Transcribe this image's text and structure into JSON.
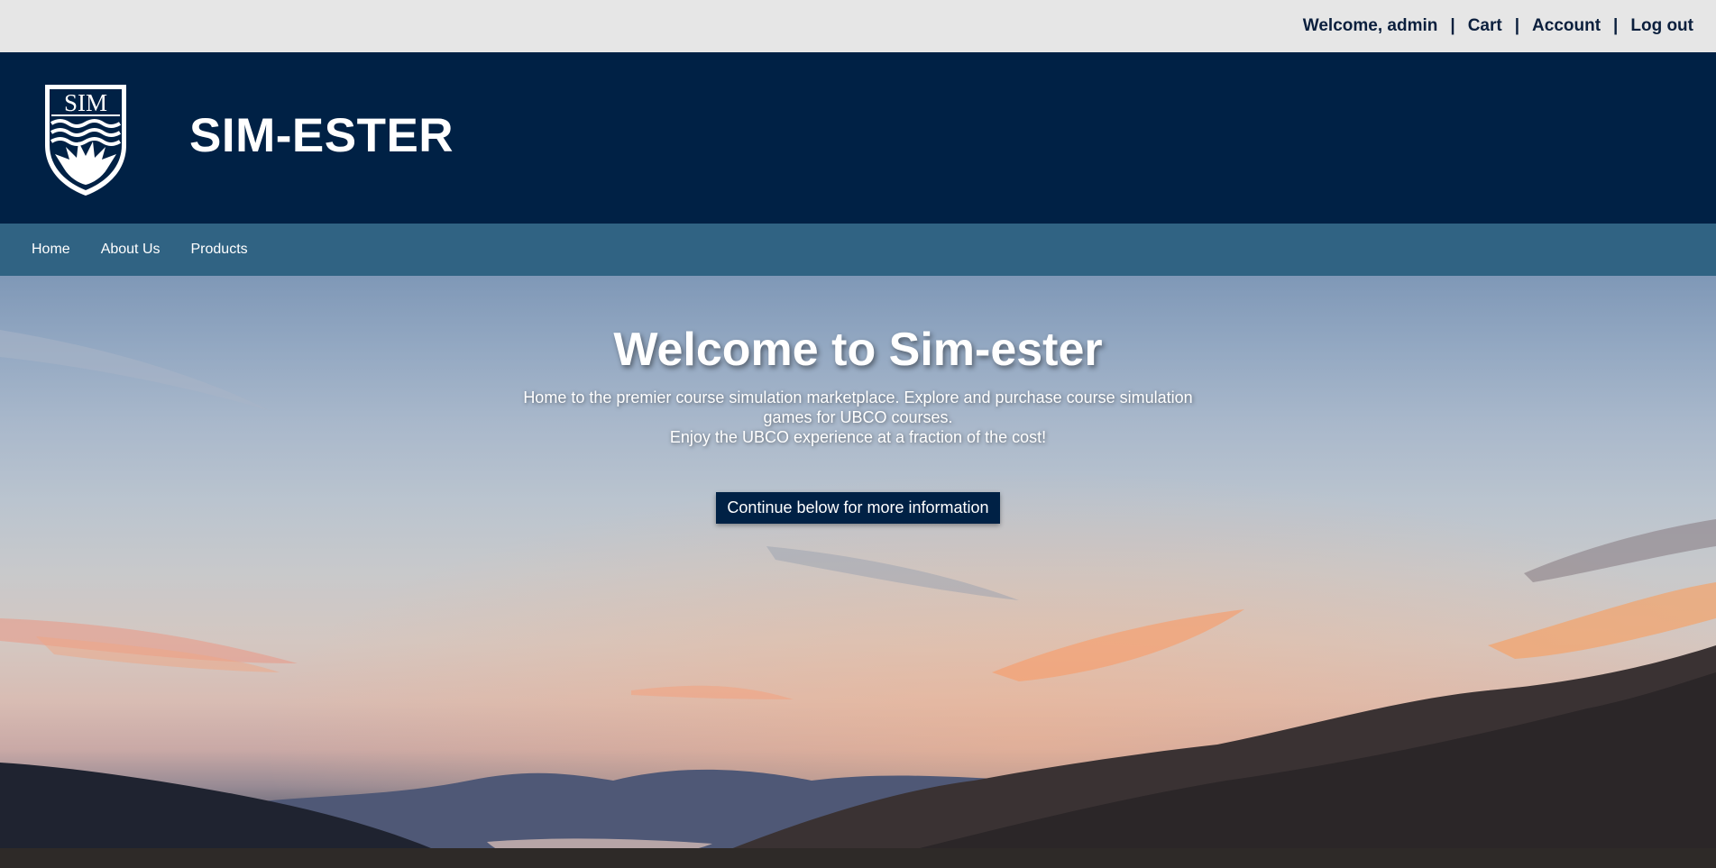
{
  "topbar": {
    "welcome": "Welcome, admin",
    "separator": "|",
    "links": [
      "Cart",
      "Account",
      "Log out"
    ]
  },
  "header": {
    "logo_text": "SIM",
    "title": "SIM-ESTER"
  },
  "nav": {
    "items": [
      "Home",
      "About Us",
      "Products"
    ]
  },
  "hero": {
    "title": "Welcome to Sim-ester",
    "subtitle_line1": "Home to the premier course simulation marketplace. Explore and purchase course simulation games for UBCO courses.",
    "subtitle_line2": "Enjoy the UBCO experience at a fraction of the cost!",
    "button_label": "Continue below for more information"
  },
  "colors": {
    "topbar_bg": "#e6e6e6",
    "header_bg": "#002145",
    "nav_bg": "#306383",
    "button_bg": "#002145"
  }
}
